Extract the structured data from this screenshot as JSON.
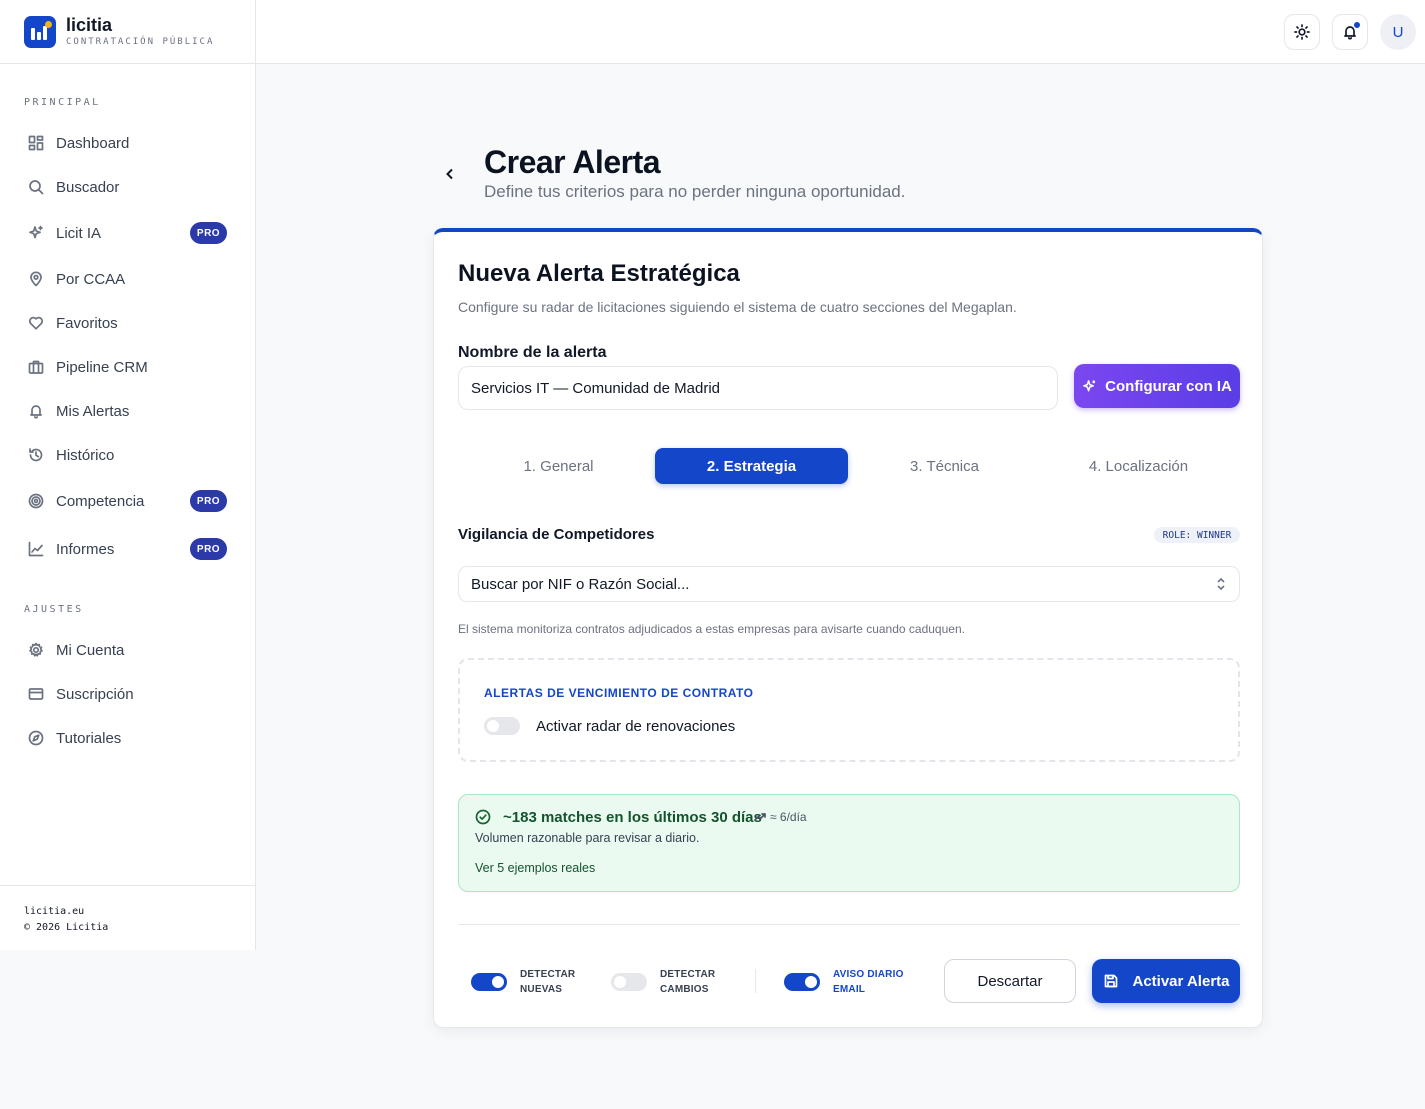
{
  "brand": {
    "name": "licitia",
    "subtitle": "CONTRATACIÓN PÚBLICA"
  },
  "sidebar": {
    "section_main": "PRINCIPAL",
    "section_settings": "AJUSTES",
    "items": [
      {
        "label": "Dashboard",
        "icon": "dashboard-icon"
      },
      {
        "label": "Buscador",
        "icon": "search-icon"
      },
      {
        "label": "Licit IA",
        "icon": "sparkles-icon",
        "badge": "PRO"
      },
      {
        "label": "Por CCAA",
        "icon": "map-pin-icon"
      },
      {
        "label": "Favoritos",
        "icon": "heart-icon"
      },
      {
        "label": "Pipeline CRM",
        "icon": "briefcase-icon"
      },
      {
        "label": "Mis Alertas",
        "icon": "bell-icon"
      },
      {
        "label": "Histórico",
        "icon": "history-icon"
      },
      {
        "label": "Competencia",
        "icon": "target-icon",
        "badge": "PRO"
      },
      {
        "label": "Informes",
        "icon": "chart-line-icon",
        "badge": "PRO"
      }
    ],
    "settings_items": [
      {
        "label": "Mi Cuenta",
        "icon": "gear-icon"
      },
      {
        "label": "Suscripción",
        "icon": "credit-card-icon"
      },
      {
        "label": "Tutoriales",
        "icon": "compass-icon"
      }
    ],
    "footer_site": "licitia.eu",
    "footer_copy": "© 2026 Licitia"
  },
  "topbar": {
    "avatar_initial": "U"
  },
  "header": {
    "title": "Crear Alerta",
    "subtitle": "Define tus criterios para no perder ninguna oportunidad."
  },
  "card": {
    "title": "Nueva Alerta Estratégica",
    "subtitle": "Configure su radar de licitaciones siguiendo el sistema de cuatro secciones del Megaplan.",
    "name_label": "Nombre de la alerta",
    "name_value": "Servicios IT — Comunidad de Madrid",
    "ia_button": "Configurar con IA",
    "tabs": [
      "1. General",
      "2. Estrategia",
      "3. Técnica",
      "4. Localización"
    ],
    "active_tab": 1,
    "section_title": "Vigilancia de Competidores",
    "role_badge": "ROLE: WINNER",
    "select_placeholder": "Buscar por NIF o Razón Social...",
    "hint": "El sistema monitoriza contratos adjudicados a estas empresas para avisarte cuando caduquen.",
    "expiry_title": "ALERTAS DE VENCIMIENTO DE CONTRATO",
    "radar_label": "Activar radar de renovaciones",
    "radar_enabled": false,
    "matches_title": "~183 matches en los últimos 30 días",
    "matches_rate": "≈ 6/día",
    "matches_sub": "Volumen razonable para revisar a diario.",
    "matches_link": "Ver 5 ejemplos reales",
    "options": [
      {
        "line1": "DETECTAR",
        "line2": "NUEVAS",
        "enabled": true
      },
      {
        "line1": "DETECTAR",
        "line2": "CAMBIOS",
        "enabled": false
      },
      {
        "line1": "AVISO DIARIO",
        "line2": "EMAIL",
        "enabled": true
      }
    ],
    "discard_button": "Descartar",
    "activate_button": "Activar Alerta"
  },
  "colors": {
    "accent": "#1346c9",
    "ia_purple": "#6c40ea",
    "pro_badge": "#2b3aa8",
    "success_bg": "#ebfaf1"
  }
}
